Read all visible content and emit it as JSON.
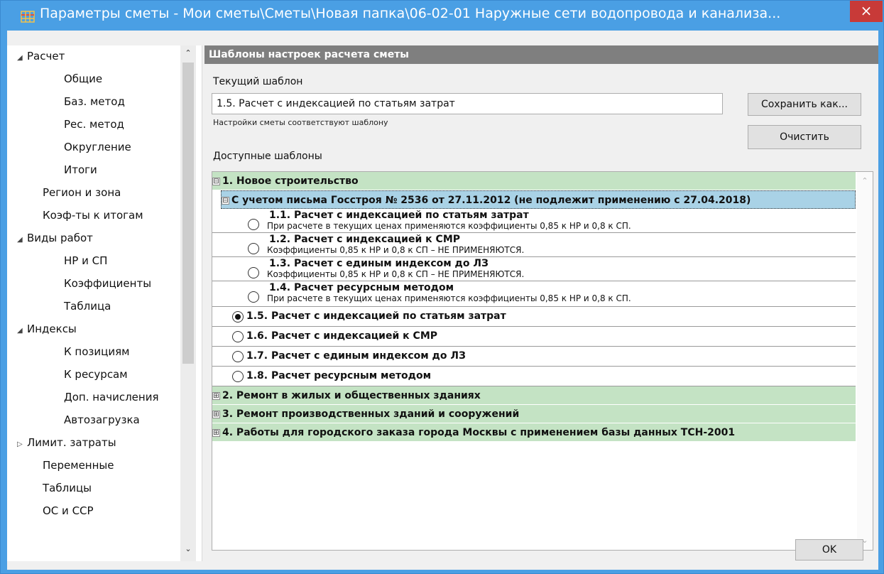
{
  "window": {
    "title": "Параметры сметы - Мои сметы\\Сметы\\Новая папка\\06-02-01 Наружные сети водопровода и канализа...",
    "close_glyph": "×"
  },
  "sidebar": {
    "items": [
      {
        "label": "Расчет",
        "tri": "◢",
        "level": 0
      },
      {
        "label": "Общие",
        "level": 2
      },
      {
        "label": "Баз. метод",
        "level": 2
      },
      {
        "label": "Рес. метод",
        "level": 2
      },
      {
        "label": "Округление",
        "level": 2
      },
      {
        "label": "Итоги",
        "level": 2
      },
      {
        "label": "Регион и зона",
        "level": 1
      },
      {
        "label": "Коэф-ты к итогам",
        "level": 1
      },
      {
        "label": "Виды работ",
        "tri": "◢",
        "level": 0
      },
      {
        "label": "НР и СП",
        "level": 2
      },
      {
        "label": "Коэффициенты",
        "level": 2
      },
      {
        "label": "Таблица",
        "level": 2
      },
      {
        "label": "Индексы",
        "tri": "◢",
        "level": 0
      },
      {
        "label": "К позициям",
        "level": 2
      },
      {
        "label": "К ресурсам",
        "level": 2
      },
      {
        "label": "Доп. начисления",
        "level": 2
      },
      {
        "label": "Автозагрузка",
        "level": 2
      },
      {
        "label": "Лимит. затраты",
        "tri": "▷",
        "level": 0
      },
      {
        "label": "Переменные",
        "level": 1
      },
      {
        "label": "Таблицы",
        "level": 1
      },
      {
        "label": "ОС и ССР",
        "level": 1
      }
    ],
    "scroll_up": "⌃",
    "scroll_down": "⌄"
  },
  "main": {
    "header": "Шаблоны настроек расчета сметы",
    "current_label": "Текущий шаблон",
    "current_value": "1.5. Расчет с индексацией по статьям затрат",
    "match_note": "Настройки сметы соответствуют шаблону",
    "save_as_label": "Сохранить как...",
    "clear_label": "Очистить",
    "available_label": "Доступные шаблоны",
    "ok_label": "OK"
  },
  "tree": {
    "group1": {
      "expander": "⊟",
      "label": "1. Новое строительство"
    },
    "subgroup": {
      "expander": "⊟",
      "label": "С учетом письма Госстроя № 2536 от 27.11.2012 (не подлежит применению с 27.04.2018)"
    },
    "sub_items": [
      {
        "title": "1.1. Расчет с индексацией по статьям затрат",
        "desc": "При расчете в текущих ценах применяются коэффициенты 0,85 к НР и 0,8 к СП."
      },
      {
        "title": "1.2. Расчет с индексацией к СМР",
        "desc": "Коэффициенты 0,85 к НР и 0,8 к СП – НЕ ПРИМЕНЯЮТСЯ."
      },
      {
        "title": "1.3. Расчет с единым индексом до ЛЗ",
        "desc": "Коэффициенты 0,85 к НР и 0,8 к СП – НЕ ПРИМЕНЯЮТСЯ."
      },
      {
        "title": "1.4. Расчет ресурсным методом",
        "desc": "При расчете в текущих ценах применяются коэффициенты 0,85 к НР и 0,8 к СП."
      }
    ],
    "items": [
      {
        "title": "1.5. Расчет с индексацией по статьям затрат",
        "checked": true
      },
      {
        "title": "1.6. Расчет с индексацией к СМР",
        "checked": false
      },
      {
        "title": "1.7. Расчет с единым индексом до ЛЗ",
        "checked": false
      },
      {
        "title": "1.8. Расчет ресурсным методом",
        "checked": false
      }
    ],
    "groups": [
      {
        "expander": "⊞",
        "label": "2. Ремонт в жилых и общественных зданиях"
      },
      {
        "expander": "⊞",
        "label": "3. Ремонт производственных зданий и сооружений"
      },
      {
        "expander": "⊞",
        "label": "4. Работы для городского заказа города Москвы с применением базы данных ТСН-2001"
      }
    ],
    "scroll_up": "⌃",
    "scroll_down": "⌄"
  }
}
